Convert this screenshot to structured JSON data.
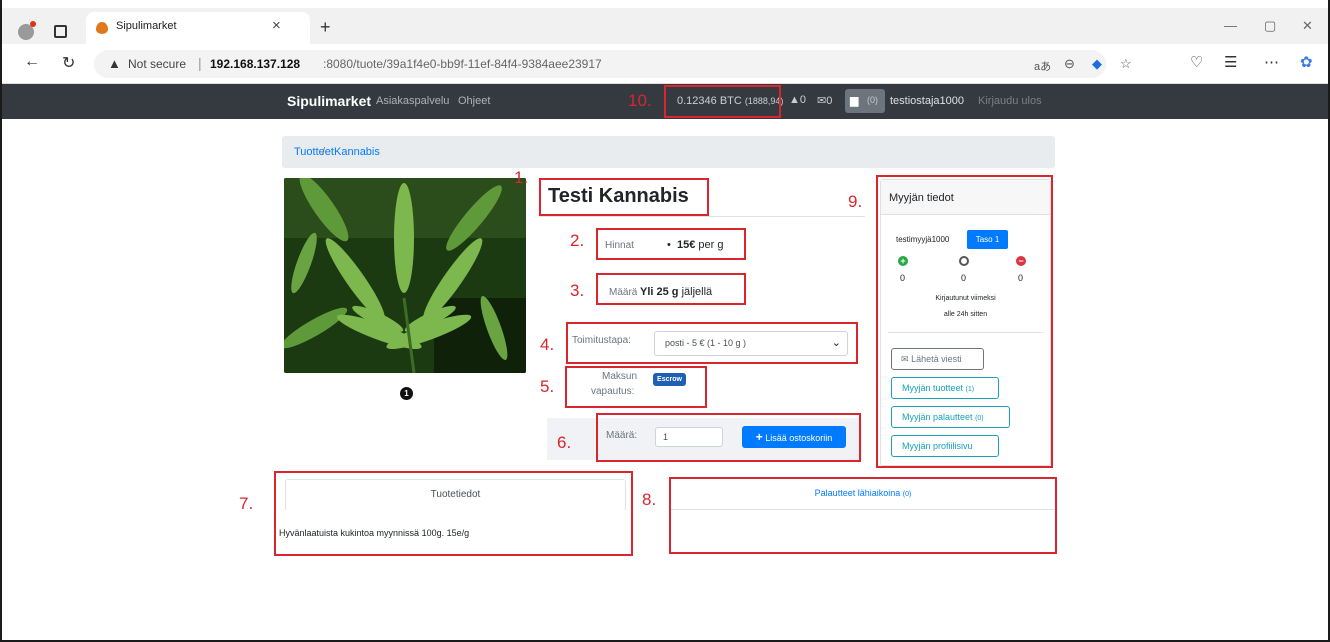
{
  "browser": {
    "tab_title": "Sipulimarket",
    "tab_close": "×",
    "new_tab": "+",
    "not_secure": "Not secure",
    "url_host": "192.168.137.128",
    "url_rest": ":8080/tuote/39a1f4e0-bb9f-11ef-84f4-9384aee23917",
    "window_minimize": "—",
    "window_maximize": "▢",
    "window_close": "✕"
  },
  "sitenav": {
    "brand": "Sipulimarket",
    "links": [
      "Asiakaspalvelu",
      "Ohjeet"
    ],
    "balance": "0.12346 BTC",
    "balance_eur": "(1888,94)",
    "notifications": "0",
    "messages": "0",
    "cart_count": "(0)",
    "username": "testiostaja1000",
    "logout": "Kirjaudu ulos"
  },
  "breadcrumb": {
    "items": [
      "Tuotteet",
      "Kannabis"
    ],
    "separator": "/"
  },
  "product": {
    "title": "Testi Kannabis",
    "price_label": "Hinnat",
    "price_value": "15€",
    "price_unit": "per g",
    "amount_label": "Määrä",
    "amount_value": "Yli 25 g",
    "amount_suffix": "jäljellä",
    "shipping_label": "Toimitustapa:",
    "shipping_selected": "posti - 5 € (1 - 10 g )",
    "payment_label_1": "Maksun",
    "payment_label_2": "vapautus:",
    "payment_badge": "Escrow",
    "qty_label": "Määrä:",
    "qty_value": "1",
    "add_to_cart": "Lisää ostoskoriin",
    "image_index": "1"
  },
  "seller": {
    "header": "Myyjän tiedot",
    "name": "testimyyjä1000",
    "level": "Taso 1",
    "positive": "0",
    "neutral": "0",
    "negative": "0",
    "last_seen_1": "Kirjautunut viimeksi",
    "last_seen_2": "alle 24h sitten",
    "send_message": "Lähetä viesti",
    "products": "Myyjän tuotteet",
    "products_count": "(1)",
    "feedback": "Myyjän palautteet",
    "feedback_count": "(0)",
    "profile": "Myyjän profiilisivu"
  },
  "tabs": {
    "description_tab": "Tuotetiedot",
    "description_text": "Hyvänlaatuista kukintoa myynnissä 100g. 15e/g",
    "feedback_tab": "Palautteet lähiaikoina",
    "feedback_count": "(0)"
  },
  "annotations": [
    "1.",
    "2.",
    "3.",
    "4.",
    "5.",
    "6.",
    "7.",
    "8.",
    "9.",
    "10."
  ],
  "colors": {
    "annotation_red": "#d9252d",
    "navbar": "#343a40",
    "primary": "#007bff",
    "info": "#17a2b8",
    "success": "#28a745",
    "danger": "#dc3545"
  }
}
